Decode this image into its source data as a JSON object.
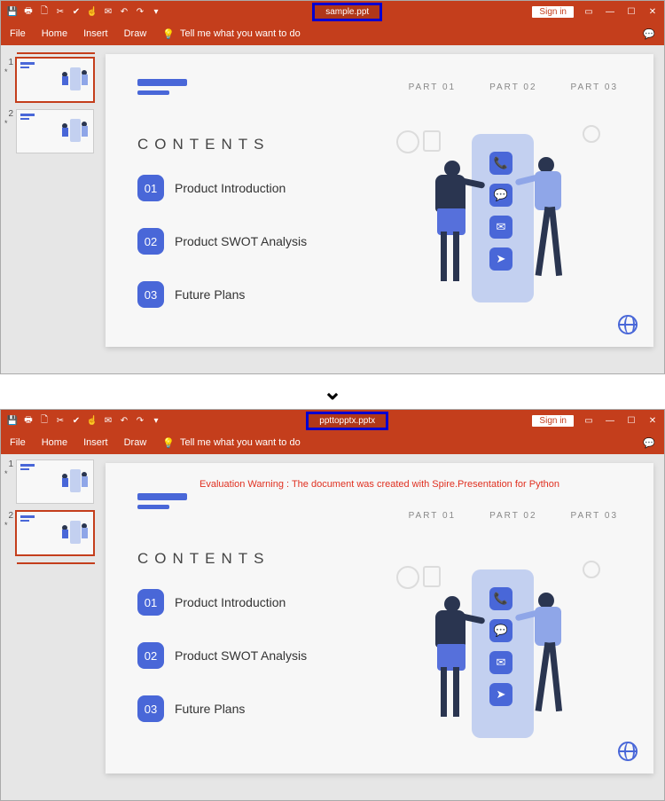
{
  "apps": [
    {
      "filename": "sample.ppt",
      "signin": "Sign in",
      "menu": [
        "File",
        "Home",
        "Insert",
        "Draw"
      ],
      "tell_me": "Tell me what you want to do",
      "thumbs": [
        {
          "num": "1",
          "star": "*",
          "selected": true
        },
        {
          "num": "2",
          "star": "*",
          "selected": false
        }
      ],
      "slide": {
        "warning": null,
        "parts": [
          "PART 01",
          "PART 02",
          "PART 03"
        ],
        "contents_title": "CONTENTS",
        "toc": [
          {
            "num": "01",
            "text": "Product Introduction"
          },
          {
            "num": "02",
            "text": "Product SWOT Analysis"
          },
          {
            "num": "03",
            "text": "Future Plans"
          }
        ]
      }
    },
    {
      "filename": "ppttopptx.pptx",
      "signin": "Sign in",
      "menu": [
        "File",
        "Home",
        "Insert",
        "Draw"
      ],
      "tell_me": "Tell me what you want to do",
      "thumbs": [
        {
          "num": "1",
          "star": "*",
          "selected": false
        },
        {
          "num": "2",
          "star": "*",
          "selected": true
        }
      ],
      "slide": {
        "warning": "Evaluation Warning : The document was created with Spire.Presentation for Python",
        "parts": [
          "PART 01",
          "PART 02",
          "PART 03"
        ],
        "contents_title": "CONTENTS",
        "toc": [
          {
            "num": "01",
            "text": "Product Introduction"
          },
          {
            "num": "02",
            "text": "Product SWOT Analysis"
          },
          {
            "num": "03",
            "text": "Future Plans"
          }
        ]
      }
    }
  ]
}
